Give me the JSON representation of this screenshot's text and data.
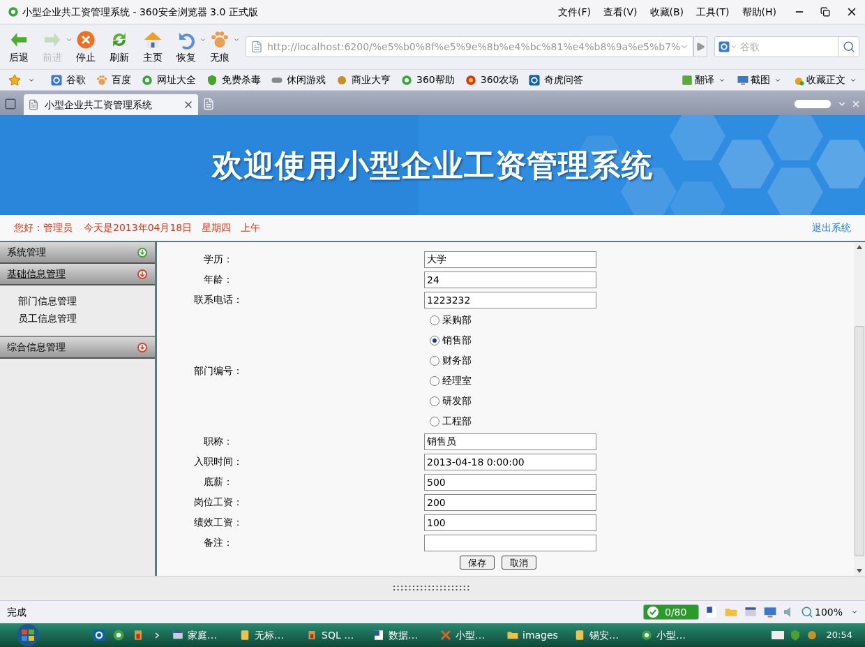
{
  "window": {
    "title": "小型企业共工资管理系统 - 360安全浏览器 3.0 正式版"
  },
  "menu": [
    "文件(F)",
    "查看(V)",
    "收藏(B)",
    "工具(T)",
    "帮助(H)"
  ],
  "toolbar": [
    {
      "label": "后退",
      "disabled": false,
      "dropdown": false
    },
    {
      "label": "前进",
      "disabled": true,
      "dropdown": true
    },
    {
      "label": "停止",
      "disabled": false,
      "dropdown": false
    },
    {
      "label": "刷新",
      "disabled": false,
      "dropdown": false
    },
    {
      "label": "主页",
      "disabled": false,
      "dropdown": false
    },
    {
      "label": "恢复",
      "disabled": false,
      "dropdown": true
    },
    {
      "label": "无痕",
      "disabled": false,
      "dropdown": true
    }
  ],
  "address": {
    "url": "http://localhost:6200/%e5%b0%8f%e5%9e%8b%e4%bc%81%e4%b8%9a%e5%b7%"
  },
  "search": {
    "placeholder": "谷歌"
  },
  "bookmarks": [
    "谷歌",
    "百度",
    "网址大全",
    "免费杀毒",
    "休闲游戏",
    "商业大亨",
    "360帮助",
    "360农场",
    "奇虎问答"
  ],
  "tools": [
    "翻译",
    "截图",
    "收藏正文"
  ],
  "tabs": [
    {
      "label": "小型企业共工资管理系统",
      "selected": true
    }
  ],
  "banner": {
    "title": "欢迎使用小型企业工资管理系统"
  },
  "info_bar": {
    "greeting": "您好：管理员",
    "date": "今天是2013年04月18日",
    "weekday": "星期四",
    "period": "上午",
    "logout": "退出系统"
  },
  "sidebar": [
    {
      "label": "系统管理",
      "expanded": false,
      "color": "#3aa63a"
    },
    {
      "label": "基础信息管理",
      "expanded": true,
      "color": "#d9402c",
      "children": [
        "部门信息管理",
        "员工信息管理"
      ]
    },
    {
      "label": "综合信息管理",
      "expanded": false,
      "color": "#d9402c"
    }
  ],
  "form": [
    {
      "kind": "text",
      "label": "学历：",
      "value": "大学"
    },
    {
      "kind": "text",
      "label": "年龄：",
      "value": "24"
    },
    {
      "kind": "text",
      "label": "联系电话：",
      "value": "1223232"
    },
    {
      "kind": "radio",
      "label": "部门编号：",
      "options": [
        {
          "label": "采购部",
          "selected": false
        },
        {
          "label": "销售部",
          "selected": true
        },
        {
          "label": "财务部",
          "selected": false
        },
        {
          "label": "经理室",
          "selected": false
        },
        {
          "label": "研发部",
          "selected": false
        },
        {
          "label": "工程部",
          "selected": false
        }
      ]
    },
    {
      "kind": "text",
      "label": "职称：",
      "value": "销售员"
    },
    {
      "kind": "text",
      "label": "入职时间：",
      "value": "2013-04-18 0:00:00"
    },
    {
      "kind": "text",
      "label": "底薪：",
      "value": "500"
    },
    {
      "kind": "text",
      "label": "岗位工资：",
      "value": "200"
    },
    {
      "kind": "text",
      "label": "绩效工资：",
      "value": "100"
    },
    {
      "kind": "text",
      "label": "备注："
    }
  ],
  "buttons": [
    "保存",
    "取消"
  ],
  "status_bar": {
    "text": "完成",
    "counter": "0/80",
    "zoom": "100%"
  },
  "taskbar": {
    "items": [
      "家庭…",
      "无标…",
      "SQL …",
      "数据…",
      "小型…",
      "images",
      "锡安…",
      "小型…"
    ],
    "clock": "20:54"
  }
}
